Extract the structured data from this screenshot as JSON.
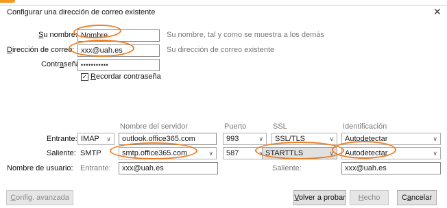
{
  "dialog": {
    "title": "Configurar una dirección de correo existente",
    "close_glyph": "✕"
  },
  "form": {
    "name_label": "Su nombre:",
    "name_value": "Nombre",
    "name_hint": "Su nombre, tal y como se muestra a los demás",
    "email_label": "Dirección de correo:",
    "email_value": "xxx@uah.es",
    "email_hint": "Su dirección de correo existente",
    "password_label": "Contraseña:",
    "password_value": "•••••••••••",
    "remember_label": "Recordar contraseña",
    "remember_checked": true
  },
  "server": {
    "col_server": "Nombre del servidor",
    "col_port": "Puerto",
    "col_ssl": "SSL",
    "col_auth": "Identificación",
    "incoming_label": "Entrante:",
    "incoming_protocol": "IMAP",
    "incoming_server": "outlook.office365.com",
    "incoming_port": "993",
    "incoming_ssl": "SSL/TLS",
    "incoming_auth": "Autodetectar",
    "outgoing_label": "Saliente:",
    "outgoing_protocol": "SMTP",
    "outgoing_server": "smtp.office365.com",
    "outgoing_port": "587",
    "outgoing_ssl": "STARTTLS",
    "outgoing_auth": "Autodetectar",
    "username_label": "Nombre de usuario:",
    "username_incoming_label": "Entrante:",
    "username_incoming_value": "xxx@uah.es",
    "username_outgoing_label": "Saliente:",
    "username_outgoing_value": "xxx@uah.es"
  },
  "buttons": {
    "advanced": "Config. avanzada",
    "retry": "Volver a probar",
    "done": "Hecho",
    "cancel": "Cancelar"
  },
  "colors": {
    "annotation": "#ee7d22",
    "brand_strip": "#f39a1e"
  }
}
